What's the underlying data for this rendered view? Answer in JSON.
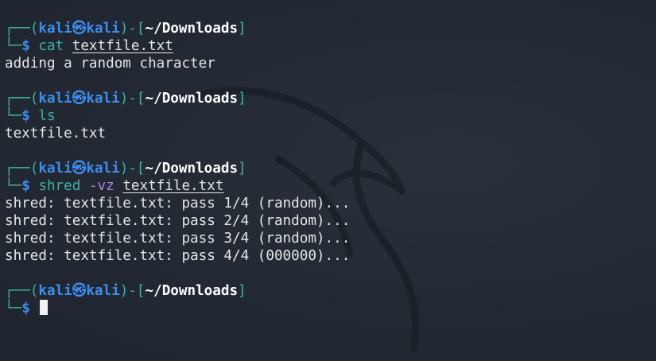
{
  "prompt": {
    "user": "kali",
    "separator_icon": "kali-dragon-icon",
    "host": "kali",
    "cwd": "~/Downloads",
    "symbol": "$"
  },
  "blocks": [
    {
      "command": "cat",
      "flags": "",
      "arg": "textfile.txt",
      "output": [
        "adding a random character"
      ]
    },
    {
      "command": "ls",
      "flags": "",
      "arg": "",
      "output": [
        "textfile.txt"
      ]
    },
    {
      "command": "shred",
      "flags": "-vz",
      "arg": "textfile.txt",
      "output": [
        "shred: textfile.txt: pass 1/4 (random)...",
        "shred: textfile.txt: pass 2/4 (random)...",
        "shred: textfile.txt: pass 3/4 (random)...",
        "shred: textfile.txt: pass 4/4 (000000)..."
      ]
    }
  ],
  "colors": {
    "background": "#222933",
    "frame": "#3fb0a6",
    "user": "#3b8ef0",
    "flag": "#b17be8",
    "text": "#e6e6e6"
  }
}
